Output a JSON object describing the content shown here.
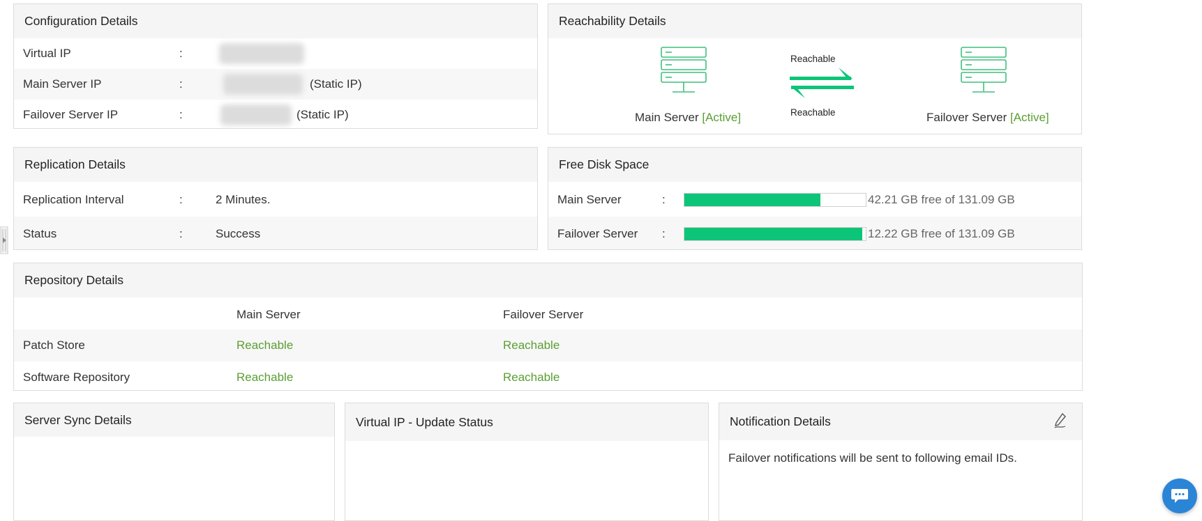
{
  "config": {
    "title": "Configuration Details",
    "rows": [
      {
        "label": "Virtual IP",
        "sep": ":",
        "suffix": ""
      },
      {
        "label": "Main Server IP",
        "sep": ":",
        "suffix": "(Static IP)"
      },
      {
        "label": "Failover Server IP",
        "sep": ":",
        "suffix": "(Static IP)"
      }
    ]
  },
  "reachability": {
    "title": "Reachability Details",
    "top_label": "Reachable",
    "bottom_label": "Reachable",
    "main": {
      "name": "Main Server",
      "status": "[Active]"
    },
    "failover": {
      "name": "Failover Server",
      "status": "[Active]"
    }
  },
  "replication": {
    "title": "Replication Details",
    "rows": [
      {
        "label": "Replication Interval",
        "sep": ":",
        "value": "2 Minutes."
      },
      {
        "label": "Status",
        "sep": ":",
        "value": "Success"
      }
    ]
  },
  "disk": {
    "title": "Free Disk Space",
    "rows": [
      {
        "label": "Main Server",
        "sep": ":",
        "used_fraction": 0.75,
        "text": "42.21 GB free of 131.09 GB"
      },
      {
        "label": "Failover Server",
        "sep": ":",
        "used_fraction": 0.98,
        "text": "12.22 GB free of 131.09 GB"
      }
    ]
  },
  "repository": {
    "title": "Repository Details",
    "columns": [
      "Main Server",
      "Failover Server"
    ],
    "rows": [
      {
        "label": "Patch Store",
        "main": "Reachable",
        "failover": "Reachable"
      },
      {
        "label": "Software Repository",
        "main": "Reachable",
        "failover": "Reachable"
      }
    ]
  },
  "sync": {
    "title": "Server Sync Details"
  },
  "vip_update": {
    "title": "Virtual IP - Update Status"
  },
  "notification": {
    "title": "Notification Details",
    "message": "Failover notifications will be sent to following email IDs."
  },
  "colors": {
    "accent_green": "#0dc578",
    "status_green": "#5a9e33",
    "icon_green": "#3fbf7f",
    "chat_blue": "#2b85d6"
  },
  "icons": [
    "server-icon",
    "sync-arrows-icon",
    "edit-icon",
    "chat-icon",
    "panel-handle-icon"
  ]
}
